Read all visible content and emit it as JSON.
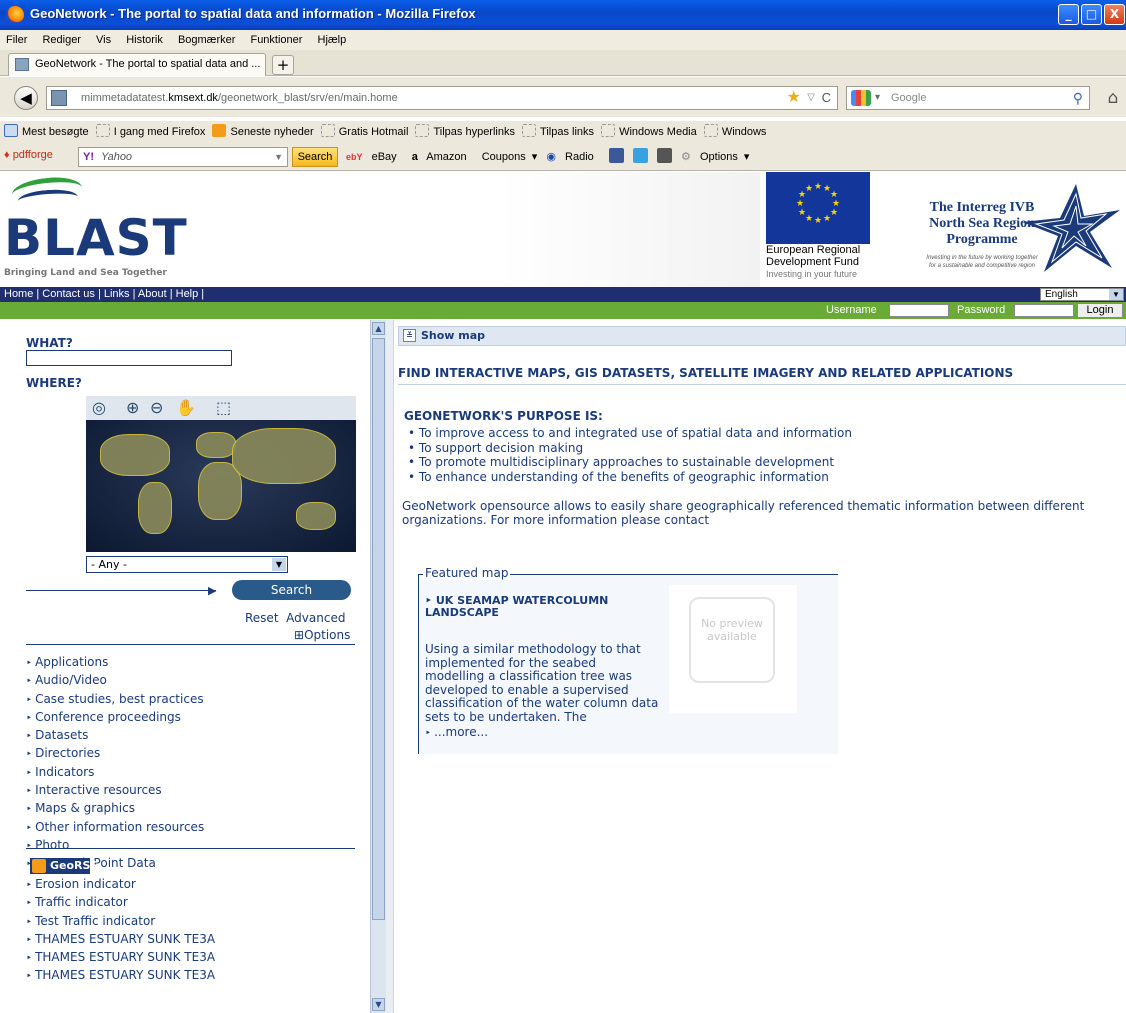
{
  "window": {
    "title": "GeoNetwork - The portal to spatial data and information - Mozilla Firefox",
    "controls": {
      "minimize": "_",
      "maximize": "□",
      "close": "X"
    }
  },
  "menu": [
    "Filer",
    "Rediger",
    "Vis",
    "Historik",
    "Bogmærker",
    "Funktioner",
    "Hjælp"
  ],
  "tab": {
    "label": "GeoNetwork - The portal to spatial data and ...",
    "new_tab": "+"
  },
  "nav": {
    "url_prefix": "mimmetadatatest.",
    "url_domain": "kmsext.dk",
    "url_path": "/geonetwork_blast/srv/en/main.home",
    "search_engine": "Google"
  },
  "bookmarks": [
    {
      "label": "Mest besøgte",
      "icon": "firefox"
    },
    {
      "label": "I gang med Firefox",
      "icon": "page"
    },
    {
      "label": "Seneste nyheder",
      "icon": "rss"
    },
    {
      "label": "Gratis Hotmail",
      "icon": "page"
    },
    {
      "label": "Tilpas hyperlinks",
      "icon": "page"
    },
    {
      "label": "Tilpas links",
      "icon": "page"
    },
    {
      "label": "Windows Media",
      "icon": "page"
    },
    {
      "label": "Windows",
      "icon": "page"
    }
  ],
  "toolbar": {
    "brand": "pdfforge",
    "yahoo_mark": "Y!",
    "yahoo_placeholder": "Yahoo",
    "search_label": "Search",
    "items": {
      "ebay": "eBay",
      "amazon": "Amazon",
      "coupons": "Coupons",
      "radio": "Radio",
      "options": "Options"
    }
  },
  "header": {
    "logo": "BLAST",
    "tagline": "Bringing Land and Sea Together",
    "eu_fund": {
      "line1": "European Regional",
      "line2": "Development Fund",
      "line3": "Investing in your future"
    },
    "interreg": {
      "line1": "The Interreg IVB",
      "line2": "North Sea Region",
      "line3": "Programme",
      "tagline1": "Investing in the future by working together",
      "tagline2": "for a sustainable and competitive region"
    }
  },
  "topnav": {
    "links": "Home | Contact us | Links | About | Help |",
    "language": "English"
  },
  "login": {
    "username_label": "Username",
    "password_label": "Password",
    "login_button": "Login"
  },
  "search_panel": {
    "what_label": "WHAT?",
    "where_label": "WHERE?",
    "region_select": "- Any -",
    "search_button": "Search",
    "reset": "Reset",
    "advanced": "Advanced",
    "options": "Options",
    "categories": [
      "Applications",
      "Audio/Video",
      "Case studies, best practices",
      "Conference proceedings",
      "Datasets",
      "Directories",
      "Indicators",
      "Interactive resources",
      "Maps & graphics",
      "Other information resources",
      "Photo",
      "TruDepth Point Data"
    ],
    "georss_label": "GeoRSS",
    "feeds": [
      "Erosion indicator",
      "Traffic indicator",
      "Test Traffic indicator",
      "THAMES ESTUARY SUNK TE3A",
      "THAMES ESTUARY SUNK TE3A",
      "THAMES ESTUARY SUNK TE3A"
    ]
  },
  "main": {
    "show_map": "Show map",
    "headline": "FIND INTERACTIVE MAPS, GIS DATASETS, SATELLITE IMAGERY AND RELATED APPLICATIONS",
    "purpose_title": "GEONETWORK'S PURPOSE IS:",
    "purpose_items": [
      "To improve access to and integrated use of spatial data and information",
      "To support decision making",
      "To promote multidisciplinary approaches to sustainable development",
      "To enhance understanding of the benefits of geographic information"
    ],
    "intro": "GeoNetwork opensource allows to easily share geographically referenced thematic information between different organizations. For more information please contact",
    "featured": {
      "legend": "Featured map",
      "title": "UK SEAMAP WATERCOLUMN LANDSCAPE",
      "description": "Using a similar methodology to that implemented for the seabed modelling a classification tree was developed to enable a supervised classification of the water column data sets to be undertaken. The",
      "more": "...more...",
      "preview_line1": "No preview",
      "preview_line2": "available"
    }
  },
  "colors": {
    "navy": "#1a3a7a",
    "green_strip": "#6aaa36",
    "dark_nav": "#1e2e6e",
    "search_btn": "#2a5a8a"
  }
}
